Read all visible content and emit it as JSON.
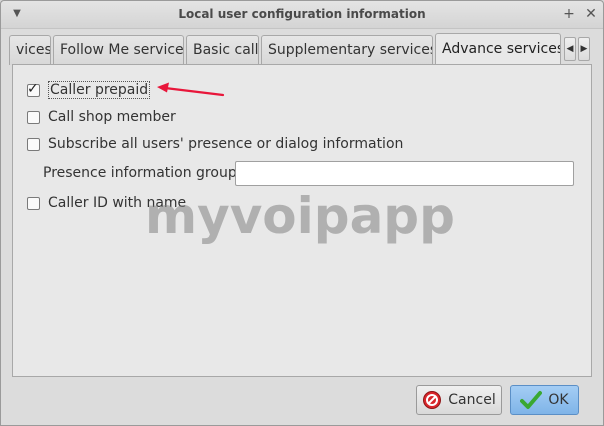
{
  "window": {
    "title": "Local user configuration information"
  },
  "tabs": [
    {
      "label": "vices",
      "active": false
    },
    {
      "label": "Follow Me service",
      "active": false
    },
    {
      "label": "Basic call",
      "active": false
    },
    {
      "label": "Supplementary services",
      "active": false
    },
    {
      "label": "Advance services",
      "active": true
    }
  ],
  "options": {
    "caller_prepaid": {
      "label": "Caller prepaid",
      "checked": true
    },
    "call_shop_member": {
      "label": "Call shop member",
      "checked": false
    },
    "subscribe_presence": {
      "label": "Subscribe all users' presence or dialog information",
      "checked": false
    },
    "presence_group": {
      "label": "Presence information group",
      "value": ""
    },
    "caller_id_name": {
      "label": "Caller ID with name",
      "checked": false
    }
  },
  "watermark": "myvoipapp",
  "buttons": {
    "cancel": "Cancel",
    "ok": "OK"
  },
  "colors": {
    "annotation_arrow": "#e8163a",
    "cancel_icon": "#d9262b",
    "ok_check": "#3aa832"
  }
}
